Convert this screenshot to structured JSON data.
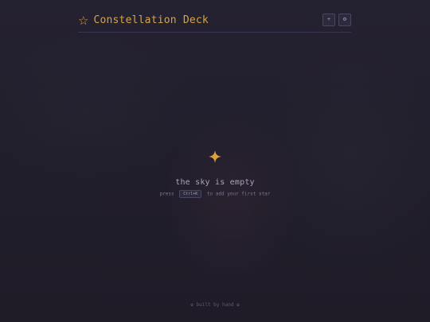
{
  "header": {
    "title_icon": "star-outline-icon",
    "title_star": "☆",
    "title": "Constellation Deck",
    "buttons": [
      {
        "name": "add-star-button",
        "icon": "plus-icon",
        "glyph": "+"
      },
      {
        "name": "settings-button",
        "icon": "gear-icon",
        "glyph": "⚙"
      }
    ]
  },
  "empty_state": {
    "icon": "sparkle-star-icon",
    "title": "the sky is empty",
    "hint_prefix": "press",
    "hint_key": "Ctrl+K",
    "hint_suffix": "to add your first star"
  },
  "footer": {
    "text": "✿ built by hand ✿"
  },
  "colors": {
    "accent": "#dba33d",
    "background": "#221f2d",
    "muted_text": "#8e879e"
  }
}
